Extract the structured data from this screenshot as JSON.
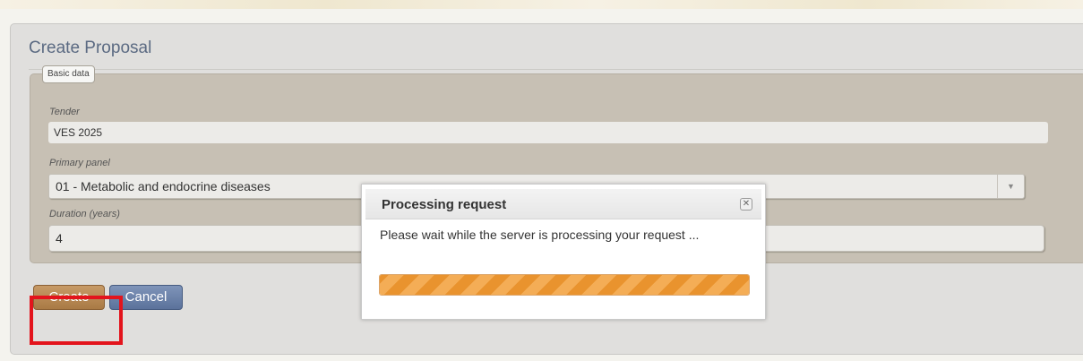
{
  "form": {
    "title": "Create Proposal",
    "fieldset_legend": "Basic data",
    "tender": {
      "label": "Tender",
      "value": "VES 2025"
    },
    "primary_panel": {
      "label": "Primary panel",
      "selected": "01 - Metabolic and endocrine diseases"
    },
    "duration": {
      "label": "Duration (years)",
      "value": "4"
    },
    "buttons": {
      "create": "Create",
      "cancel": "Cancel"
    }
  },
  "modal": {
    "title": "Processing request",
    "message": "Please wait while the server is processing your request ...",
    "progress_percent": 100
  },
  "icons": {
    "modal_close": "close-icon",
    "select_arrow": "chevron-down-icon"
  },
  "colors": {
    "create_button": "#b98955",
    "cancel_button": "#6b82aa",
    "progress_bar": "#f0a450",
    "highlight": "#e3141c"
  }
}
